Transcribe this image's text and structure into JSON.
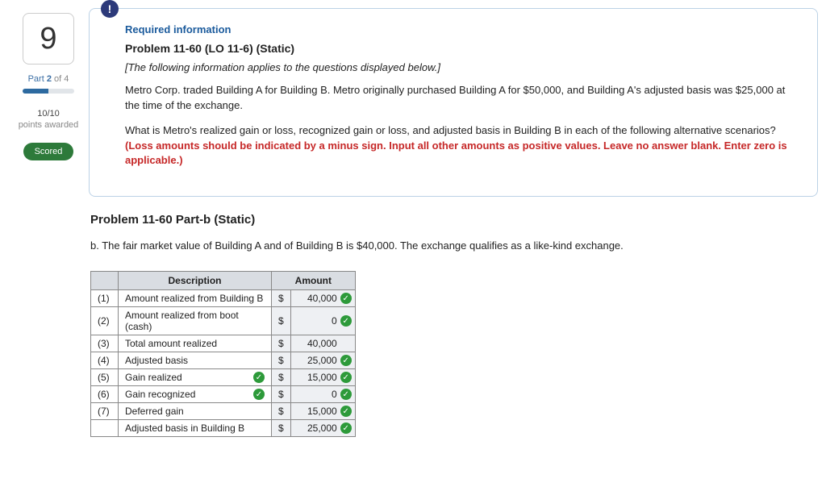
{
  "sidebar": {
    "question_number": "9",
    "part_prefix": "Part",
    "part_cur": "2",
    "part_of": "of",
    "part_total": "4",
    "points_value": "10/10",
    "points_label": "points awarded",
    "scored_label": "Scored"
  },
  "info": {
    "bang": "!",
    "required_heading": "Required information",
    "problem_title": "Problem 11-60 (LO 11-6) (Static)",
    "applies_note": "[The following information applies to the questions displayed below.]",
    "para1": "Metro Corp. traded Building A for Building B. Metro originally purchased Building A for $50,000, and Building A's adjusted basis was $25,000 at the time of the exchange.",
    "para2_lead": "What is Metro's realized gain or loss, recognized gain or loss, and adjusted basis in Building B in each of the following alternative scenarios? ",
    "para2_red": "(Loss amounts should be indicated by a minus sign. Input all other amounts as positive values. Leave no answer blank. Enter zero is applicable.)"
  },
  "partb": {
    "title": "Problem 11-60 Part-b (Static)",
    "text": "b. The fair market value of Building A and of Building B is $40,000. The exchange qualifies as a like-kind exchange."
  },
  "table": {
    "head_desc": "Description",
    "head_amt": "Amount",
    "dollar": "$",
    "rows": [
      {
        "idx": "(1)",
        "desc": "Amount realized from Building B",
        "amt": "40,000",
        "amt_check": true,
        "desc_check": false,
        "nodollar": false
      },
      {
        "idx": "(2)",
        "desc": "Amount realized from boot (cash)",
        "amt": "0",
        "amt_check": true,
        "desc_check": false,
        "nodollar": false
      },
      {
        "idx": "(3)",
        "desc": "Total amount realized",
        "amt": "40,000",
        "amt_check": false,
        "desc_check": false,
        "nodollar": false
      },
      {
        "idx": "(4)",
        "desc": "Adjusted basis",
        "amt": "25,000",
        "amt_check": true,
        "desc_check": false,
        "nodollar": false
      },
      {
        "idx": "(5)",
        "desc": "Gain realized",
        "amt": "15,000",
        "amt_check": true,
        "desc_check": true,
        "nodollar": false
      },
      {
        "idx": "(6)",
        "desc": "Gain recognized",
        "amt": "0",
        "amt_check": true,
        "desc_check": true,
        "nodollar": false
      },
      {
        "idx": "(7)",
        "desc": "Deferred gain",
        "amt": "15,000",
        "amt_check": true,
        "desc_check": false,
        "nodollar": false
      },
      {
        "idx": "",
        "desc": "Adjusted basis in Building B",
        "amt": "25,000",
        "amt_check": true,
        "desc_check": false,
        "nodollar": false
      }
    ]
  }
}
